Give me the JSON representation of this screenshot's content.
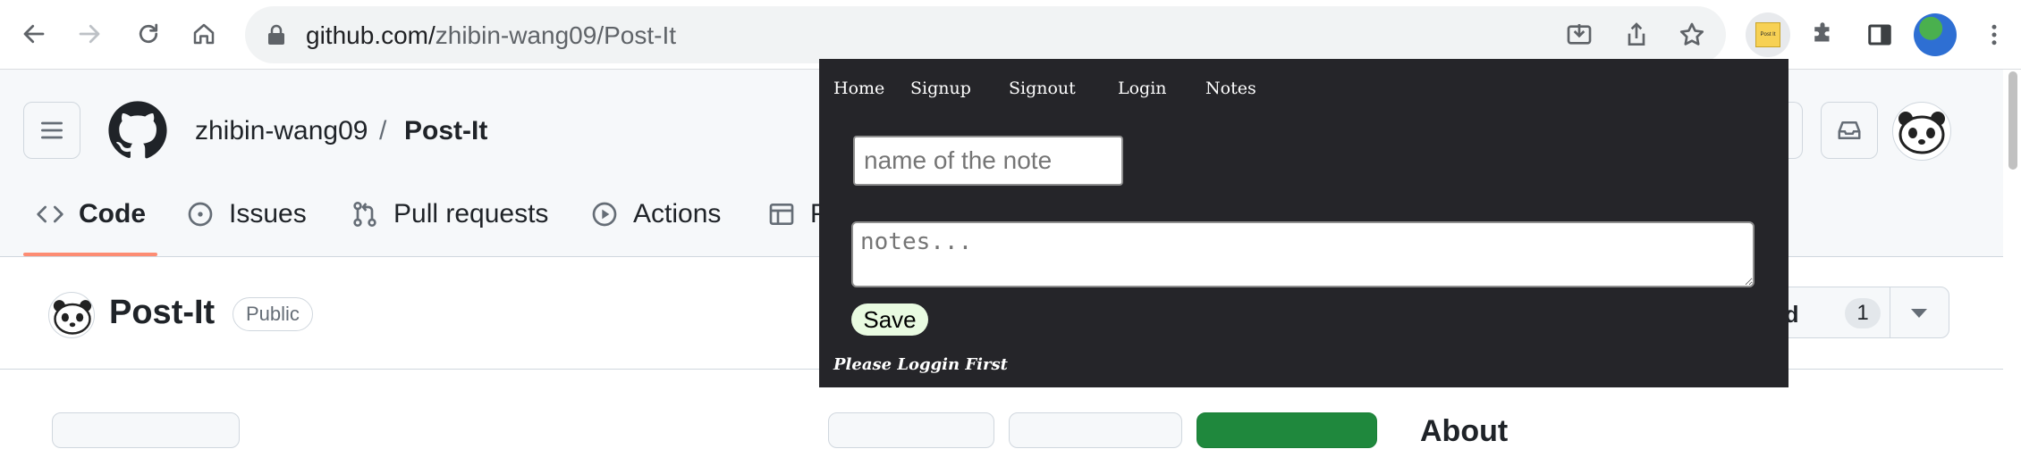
{
  "browser": {
    "url_host": "github.com/",
    "url_path": "zhibin-wang09/Post-It",
    "extension_label": "Post It"
  },
  "header": {
    "owner": "zhibin-wang09",
    "separator": "/",
    "repo": "Post-It"
  },
  "tabs": [
    {
      "label": "Code",
      "icon": "code-icon"
    },
    {
      "label": "Issues",
      "icon": "issue-icon"
    },
    {
      "label": "Pull requests",
      "icon": "pull-request-icon"
    },
    {
      "label": "Actions",
      "icon": "actions-icon"
    },
    {
      "label": "P",
      "icon": "projects-icon"
    }
  ],
  "repo_row": {
    "name": "Post-It",
    "visibility": "Public",
    "star_label": "red",
    "star_count": "1"
  },
  "about": {
    "heading": "About"
  },
  "popup": {
    "nav": [
      "Home",
      "Signup",
      "Signout",
      "Login",
      "Notes"
    ],
    "note_name_placeholder": "name of the note",
    "notes_placeholder": "notes...",
    "save_label": "Save",
    "status": "Please Loggin First"
  },
  "colors": {
    "popup_bg": "#252529",
    "save_bg": "#e9fbe1",
    "tab_underline": "#fd8c73"
  }
}
